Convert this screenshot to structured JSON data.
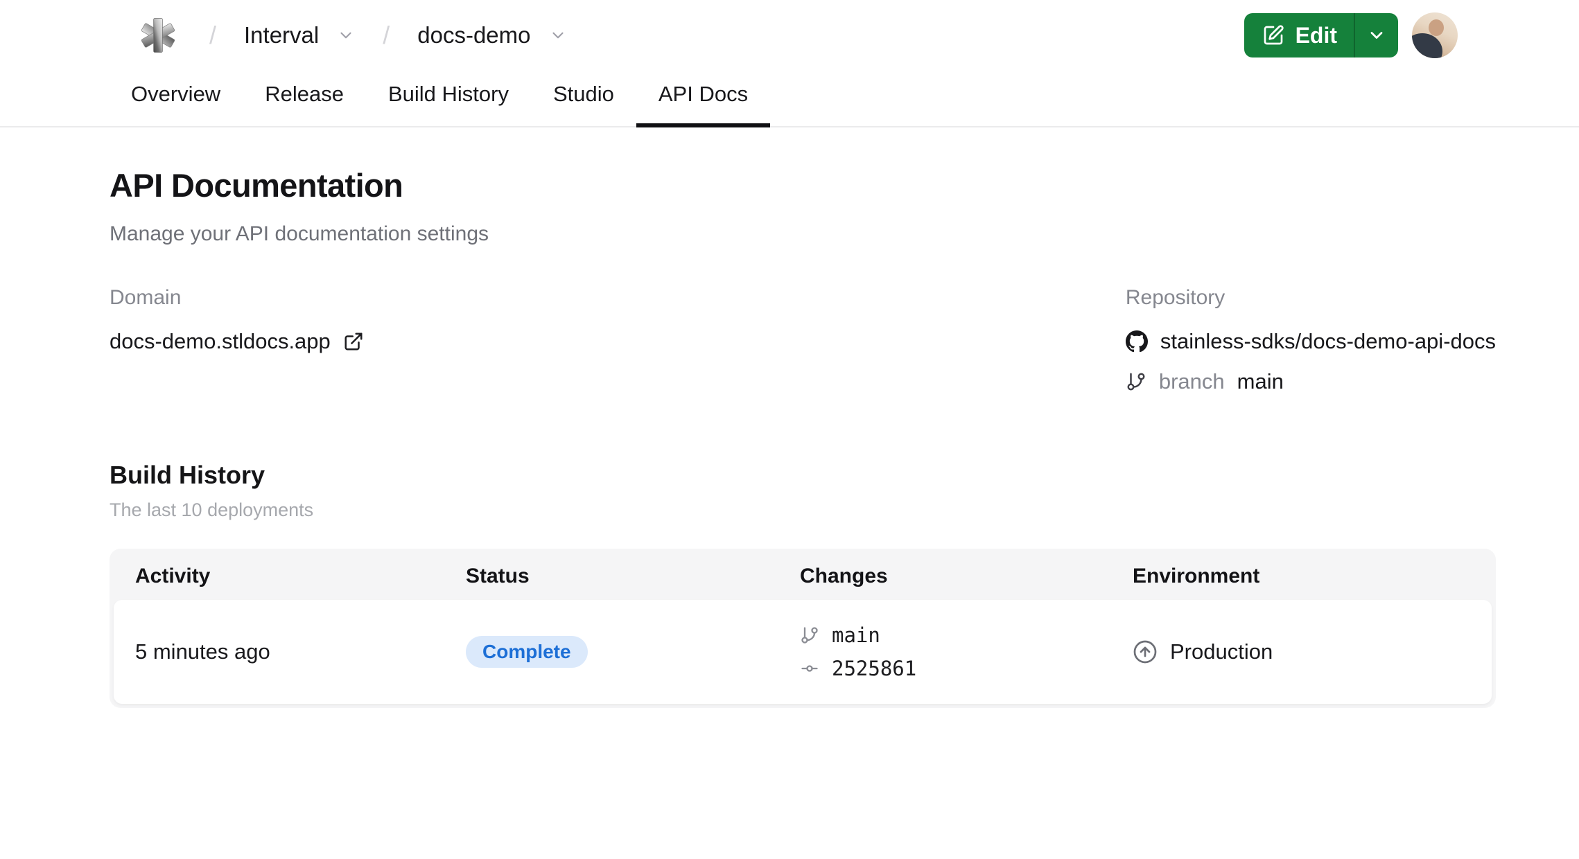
{
  "header": {
    "logo": "stainless-asterisk-logo",
    "breadcrumb": {
      "separator": "/",
      "org": "Interval",
      "project": "docs-demo"
    },
    "edit_button": {
      "label": "Edit"
    }
  },
  "tabs": [
    {
      "label": "Overview"
    },
    {
      "label": "Release"
    },
    {
      "label": "Build History"
    },
    {
      "label": "Studio"
    },
    {
      "label": "API Docs",
      "active": true
    }
  ],
  "page": {
    "title": "API Documentation",
    "subtitle": "Manage your API documentation settings"
  },
  "domain": {
    "label": "Domain",
    "value": "docs-demo.stldocs.app"
  },
  "repository": {
    "label": "Repository",
    "name": "stainless-sdks/docs-demo-api-docs",
    "branch_label": "branch",
    "branch_name": "main"
  },
  "build_history": {
    "title": "Build History",
    "subtitle": "The last 10 deployments",
    "table": {
      "headers": [
        "Activity",
        "Status",
        "Changes",
        "Environment"
      ],
      "rows": [
        {
          "activity": "5 minutes ago",
          "status": "Complete",
          "branch": "main",
          "commit": "2525861",
          "environment": "Production"
        }
      ]
    }
  },
  "icons": {
    "edit": "square-pen-icon",
    "caret": "chevron-down-icon",
    "external": "external-link-icon",
    "github": "github-mark-icon",
    "branch": "git-branch-icon",
    "commit": "git-commit-icon",
    "environment": "circle-arrow-up-icon"
  },
  "colors": {
    "accent_green": "#15813b",
    "badge_bg": "#dbe9fb",
    "badge_text": "#1d6fd6",
    "active_tab_underline": "#101013",
    "muted_text": "#85878f"
  }
}
